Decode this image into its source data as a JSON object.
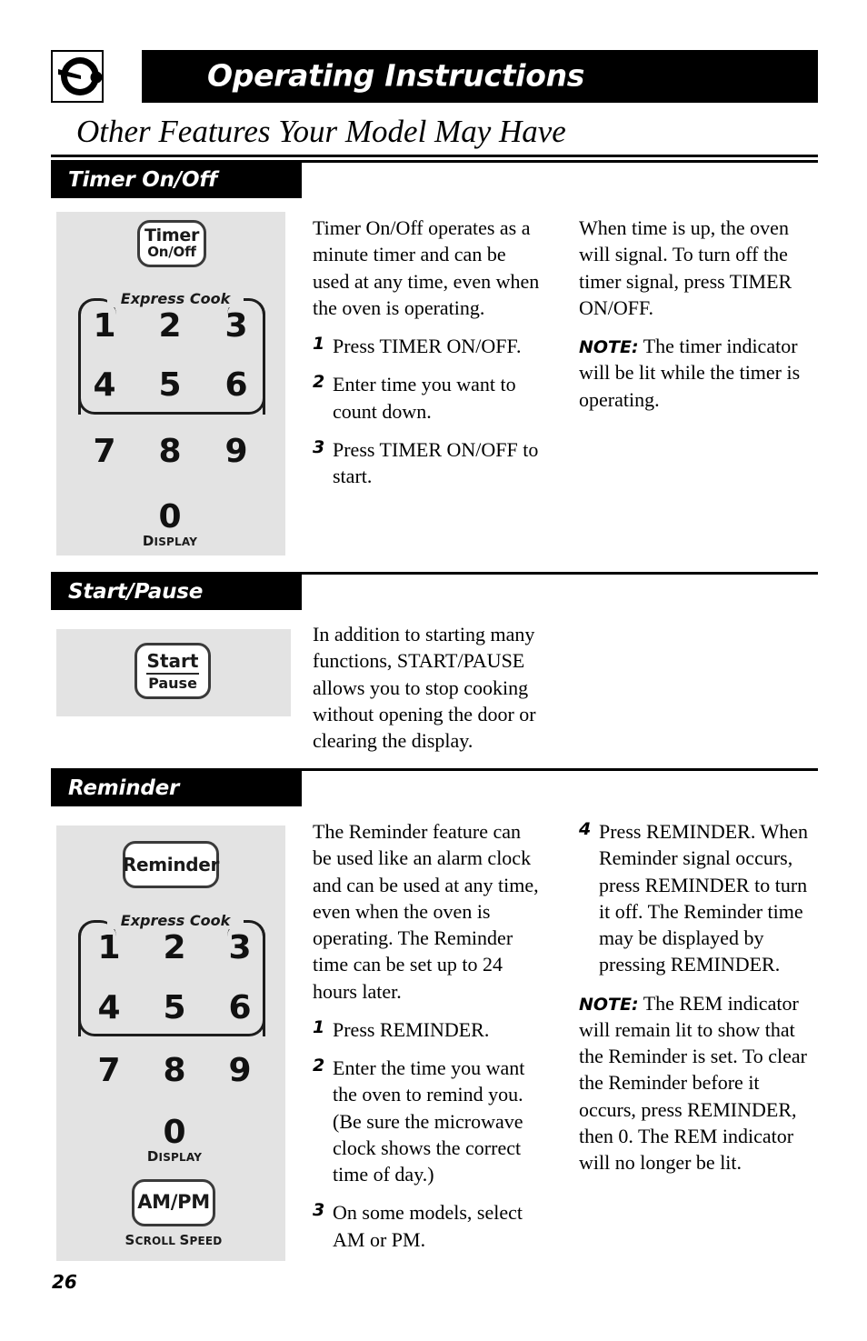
{
  "header": {
    "logo_icon": "knob-dial-icon",
    "title": "Operating Instructions"
  },
  "page_title": "Other Features Your Model May Have",
  "page_number": "26",
  "sections": [
    {
      "id": "timer-on-off",
      "heading": "Timer On/Off",
      "panel": {
        "button": {
          "line1": "Timer",
          "line2": "On/Off"
        },
        "express_cook_label": "Express Cook",
        "keys": [
          "1",
          "2",
          "3",
          "4",
          "5",
          "6",
          "7",
          "8",
          "9",
          "0"
        ],
        "zero_sublabel": "Display"
      },
      "col_middle": {
        "intro": "Timer On/Off operates as a minute timer and can be used at any time, even when the oven is operating.",
        "steps": [
          {
            "num": "1",
            "text": "Press TIMER ON/OFF."
          },
          {
            "num": "2",
            "text": "Enter time you want to count down."
          },
          {
            "num": "3",
            "text": "Press TIMER ON/OFF to start."
          }
        ]
      },
      "col_right": {
        "para": "When time is up, the oven will signal. To turn off the timer signal, press TIMER ON/OFF.",
        "note_label": "NOTE:",
        "note_text": " The timer indicator will be lit while the timer is operating."
      }
    },
    {
      "id": "start-pause",
      "heading": "Start/Pause",
      "panel": {
        "button": {
          "line1": "Start",
          "line2": "Pause"
        }
      },
      "col_middle": {
        "intro": "In addition to starting many functions, START/PAUSE allows you to stop cooking without opening the door or clearing the display."
      }
    },
    {
      "id": "reminder",
      "heading": "Reminder",
      "panel": {
        "button": {
          "line1": "Reminder"
        },
        "express_cook_label": "Express Cook",
        "keys": [
          "1",
          "2",
          "3",
          "4",
          "5",
          "6",
          "7",
          "8",
          "9",
          "0"
        ],
        "zero_sublabel": "Display",
        "ampm_button": "AM/PM",
        "ampm_sublabel": "Scroll Speed"
      },
      "col_middle": {
        "intro": "The Reminder feature can be used like an alarm clock and can be used at any time, even when the oven is operating. The Reminder time can be set up to 24 hours later.",
        "steps": [
          {
            "num": "1",
            "text": "Press REMINDER."
          },
          {
            "num": "2",
            "text": "Enter the time you want the oven to remind you. (Be sure the microwave clock shows the correct time of day.)"
          },
          {
            "num": "3",
            "text": "On some models, select AM or PM."
          }
        ]
      },
      "col_right": {
        "steps": [
          {
            "num": "4",
            "text": "Press REMINDER. When Reminder signal occurs, press REMINDER to turn it off. The Reminder time may be displayed by pressing REMINDER."
          }
        ],
        "note_label": "NOTE:",
        "note_text": " The REM indicator will remain lit to show that the Reminder is set. To clear the Reminder before it occurs, press REMINDER, then 0. The REM indicator will no longer be lit."
      }
    }
  ],
  "colors": {
    "bar": "#000000",
    "panel_gray": "#e3e3e3",
    "text": "#000000"
  }
}
